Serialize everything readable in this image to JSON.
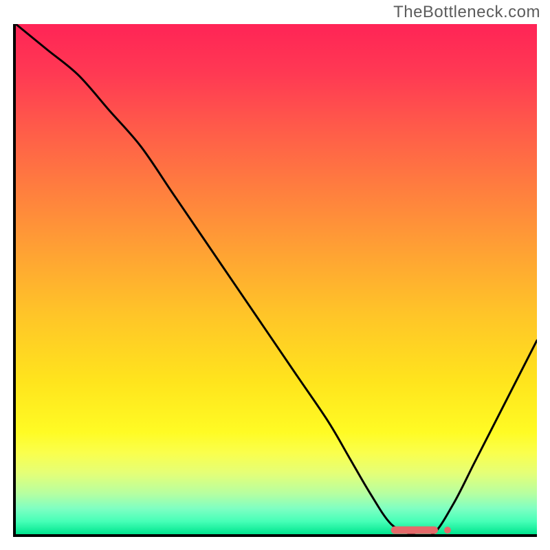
{
  "watermark": "TheBottleneck.com",
  "colors": {
    "curve": "#000000",
    "marker_fill": "#e46a6a",
    "marker_stroke": "#d25a5a",
    "top": "#ff2456",
    "bottom": "#00e58e"
  },
  "chart_data": {
    "type": "line",
    "title": "",
    "xlabel": "",
    "ylabel": "",
    "xlim": [
      0,
      100
    ],
    "ylim": [
      0,
      100
    ],
    "grid": false,
    "legend": false,
    "x": [
      0,
      6,
      12,
      18,
      24,
      30,
      36,
      42,
      48,
      54,
      60,
      64,
      68,
      72,
      76,
      80,
      84,
      88,
      92,
      96,
      100
    ],
    "values": [
      100,
      95,
      90,
      83,
      76,
      67,
      58,
      49,
      40,
      31,
      22,
      15,
      8,
      2,
      0,
      0,
      6,
      14,
      22,
      30,
      38
    ],
    "optimal_range_x": [
      72,
      81
    ],
    "marker_y": 0.8
  }
}
